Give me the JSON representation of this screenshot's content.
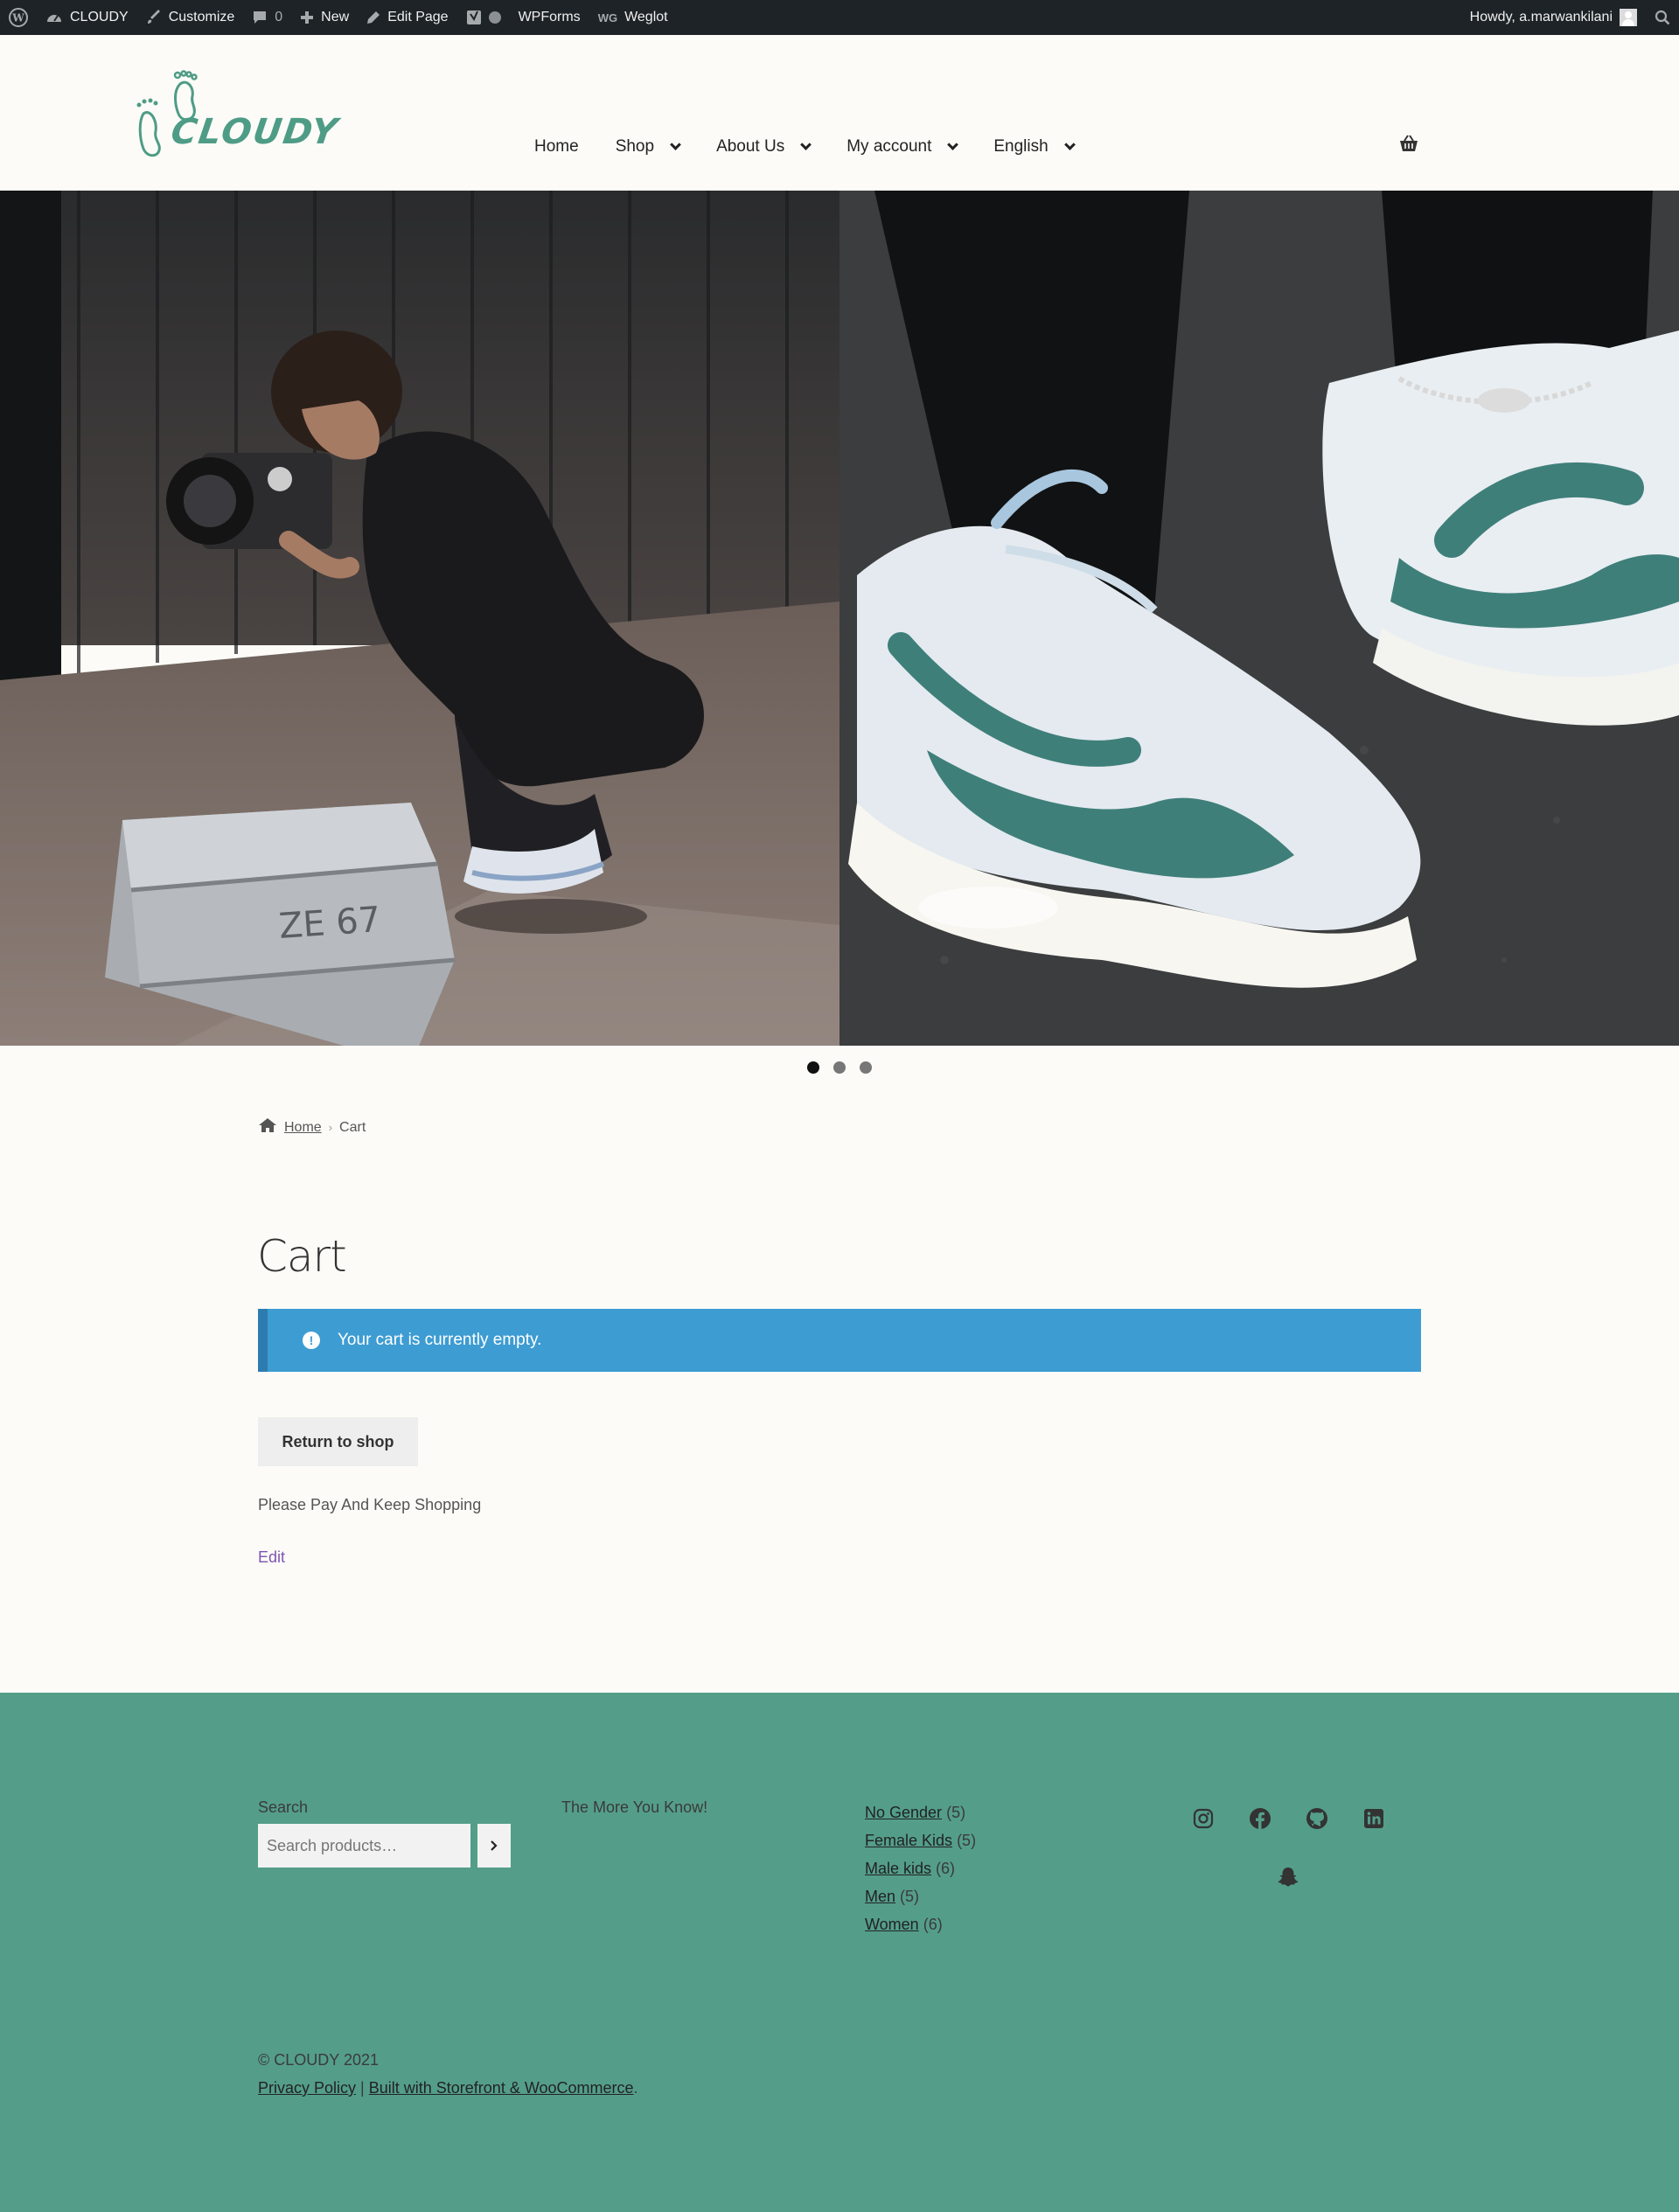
{
  "adminbar": {
    "site_name": "CLOUDY",
    "customize": "Customize",
    "comments_count": "0",
    "new": "New",
    "edit_page": "Edit Page",
    "wpforms": "WPForms",
    "weglot_logo": "WG",
    "weglot": "Weglot",
    "howdy": "Howdy, a.marwankilani"
  },
  "header": {
    "logo_text": "CLOUDY",
    "nav": [
      {
        "label": "Home",
        "has_dropdown": false
      },
      {
        "label": "Shop",
        "has_dropdown": true
      },
      {
        "label": "About Us",
        "has_dropdown": true
      },
      {
        "label": "My account",
        "has_dropdown": true
      },
      {
        "label": "English",
        "has_dropdown": true
      }
    ]
  },
  "slider": {
    "slide_count": 3,
    "active_index": 0
  },
  "breadcrumb": {
    "home": "Home",
    "current": "Cart"
  },
  "main": {
    "title": "Cart",
    "notice": "Your cart is currently empty.",
    "return_button": "Return to shop",
    "text": "Please Pay And Keep Shopping",
    "edit_link": "Edit"
  },
  "footer": {
    "search_label": "Search",
    "search_placeholder": "Search products…",
    "more_text": "The More You Know!",
    "categories": [
      {
        "name": "No Gender",
        "count": "(5)"
      },
      {
        "name": "Female Kids",
        "count": "(5)"
      },
      {
        "name": "Male kids",
        "count": "(6)"
      },
      {
        "name": "Men",
        "count": "(5)"
      },
      {
        "name": "Women",
        "count": "(6)"
      }
    ],
    "social_icons": [
      "instagram-icon",
      "facebook-icon",
      "github-icon",
      "linkedin-icon",
      "snapchat-icon"
    ],
    "copyright": "© CLOUDY 2021",
    "privacy": "Privacy Policy",
    "separator": "|",
    "built_with": "Built with Storefront & WooCommerce",
    "period": "."
  },
  "colors": {
    "adminbar_bg": "#1d2327",
    "page_bg": "#fcfbf7",
    "brand_green": "#4f9c86",
    "footer_bg": "#549e89",
    "notice_blue": "#3d9cd2",
    "link_purple": "#7f54b3"
  }
}
